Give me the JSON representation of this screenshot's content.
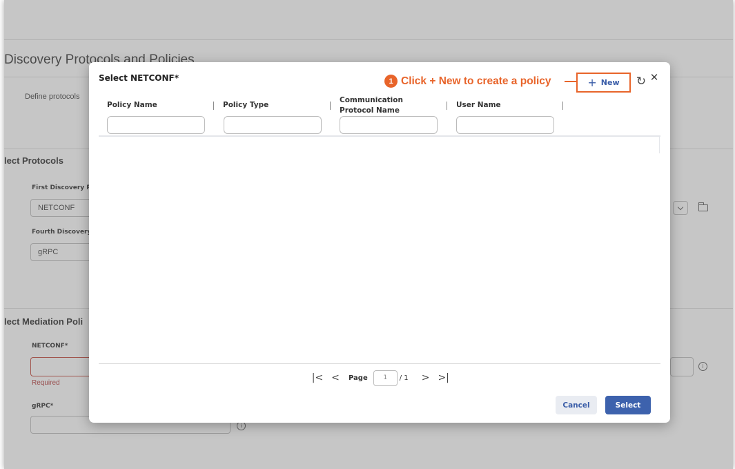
{
  "background": {
    "page_title": "Discovery Protocols and Policies",
    "description": "Define protocols",
    "section_protocols": "lect Protocols",
    "first_discovery_label": "First Discovery Pr",
    "first_discovery_value": "NETCONF",
    "fourth_discovery_label": "Fourth Discovery",
    "fourth_discovery_value": "gRPC",
    "section_mediation": "lect Mediation Poli",
    "netconf_label": "NETCONF*",
    "required_text": "Required",
    "grpc_label": "gRPC*"
  },
  "modal": {
    "title": "Select NETCONF*",
    "callout": {
      "number": "1",
      "text": "Click + New to create a policy",
      "color": "#e8642a"
    },
    "new_button": {
      "icon": "+",
      "label": "New"
    },
    "refresh_icon": "↻",
    "close_icon": "✕",
    "columns": [
      {
        "label": "Policy Name"
      },
      {
        "label": "Policy Type"
      },
      {
        "label": "Communication Protocol Name"
      },
      {
        "label": "User Name"
      }
    ],
    "pagination": {
      "first": "|<",
      "prev": "<",
      "label": "Page",
      "current": "1",
      "total": "/ 1",
      "next": ">",
      "last": ">|"
    },
    "cancel_label": "Cancel",
    "select_label": "Select",
    "accent_color": "#3d62ad"
  }
}
